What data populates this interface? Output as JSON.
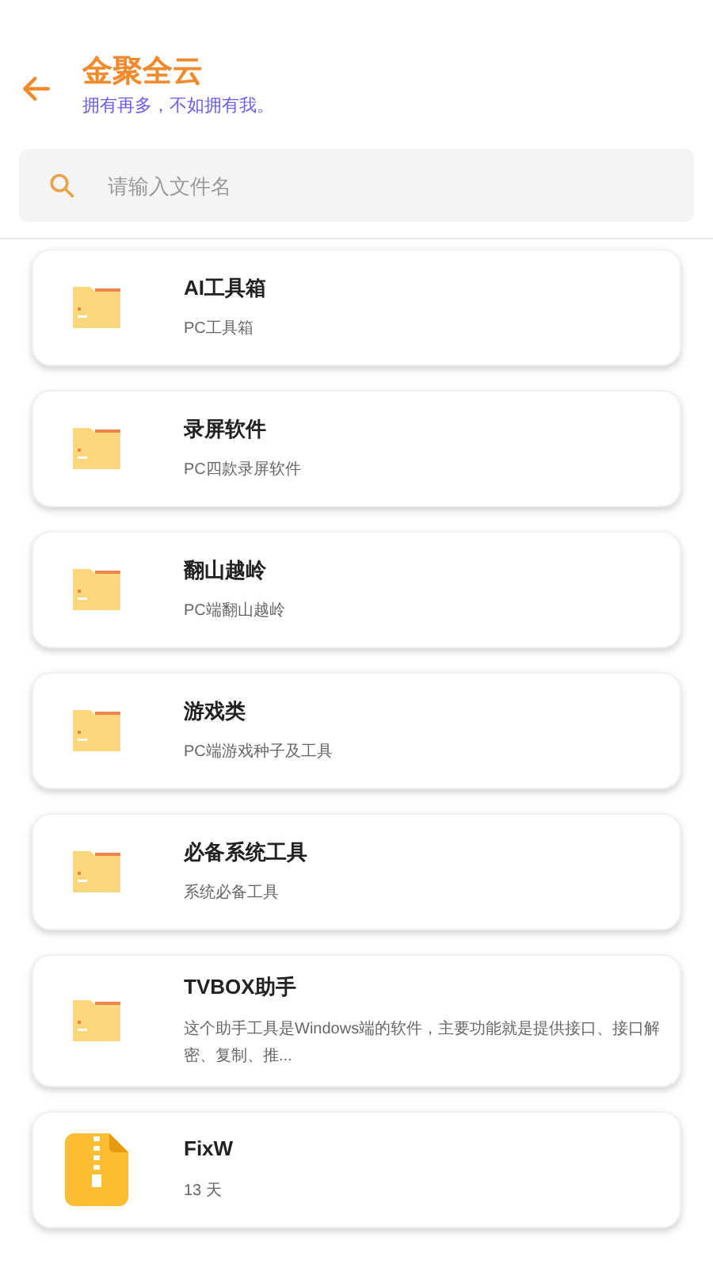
{
  "header": {
    "title": "金聚全云",
    "subtitle": "拥有再多，不如拥有我。"
  },
  "search": {
    "placeholder": "请输入文件名"
  },
  "items": [
    {
      "kind": "folder",
      "name": "AI工具箱",
      "description": "PC工具箱"
    },
    {
      "kind": "folder",
      "name": "录屏软件",
      "description": "PC四款录屏软件"
    },
    {
      "kind": "folder",
      "name": "翻山越岭",
      "description": "PC端翻山越岭"
    },
    {
      "kind": "folder",
      "name": "游戏类",
      "description": "PC端游戏种子及工具"
    },
    {
      "kind": "folder",
      "name": "必备系统工具",
      "description": "系统必备工具"
    },
    {
      "kind": "folder",
      "name": "TVBOX助手",
      "description": "这个助手工具是Windows端的软件，主要功能就是提供接口、接口解密、复制、推..."
    },
    {
      "kind": "archive",
      "name": "FixW",
      "description": "13 天"
    }
  ]
}
